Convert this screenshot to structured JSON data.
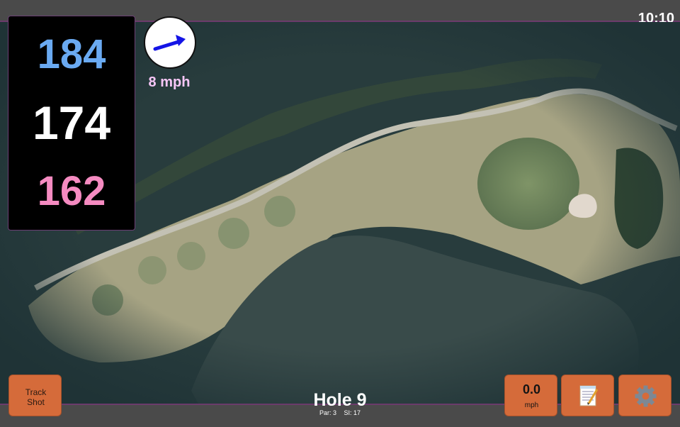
{
  "status": {
    "time": "10:10"
  },
  "distances": {
    "back": "184",
    "middle": "174",
    "front": "162"
  },
  "wind": {
    "speed_label": "8 mph",
    "direction_icon": "wind-arrow-icon",
    "arrow_color": "#1414e6"
  },
  "hole": {
    "title": "Hole 9",
    "par_label": "Par: 3",
    "si_label": "SI: 17"
  },
  "buttons": {
    "track_shot_line1": "Track",
    "track_shot_line2": "Shot",
    "speed_value": "0.0",
    "speed_unit": "mph",
    "notes_icon": "notepad-icon",
    "settings_icon": "gear-icon"
  },
  "colors": {
    "back_distance": "#6aaaf2",
    "middle_distance": "#ffffff",
    "front_distance": "#f58bc1",
    "button_orange": "#d56b3a",
    "accent_purple": "#6b3b6b"
  }
}
